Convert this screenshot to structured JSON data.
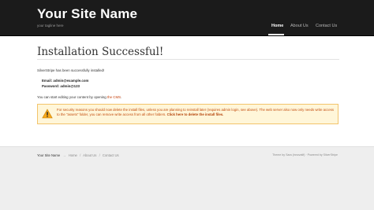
{
  "header": {
    "site_name": "Your Site Name",
    "tagline": "your tagline here",
    "nav": [
      {
        "label": "Home",
        "active": true
      },
      {
        "label": "About Us",
        "active": false
      },
      {
        "label": "Contact Us",
        "active": false
      }
    ]
  },
  "main": {
    "title": "Installation Successful!",
    "intro": "SilverStripe has been successfully installed!",
    "email_line": "Email: admin@example.com",
    "password_line": "Password: admin@123",
    "edit_text": "You can start editing your content by opening",
    "cms_link": "the CMS",
    "edit_suffix": "."
  },
  "warning": {
    "line1": "For security reasons you should now delete the install files, unless you are planning to reinstall later (requires admin login, see above). The web server also now only needs",
    "line2": "write access to the \"assets\" folder, you can remove write access from all other folders.",
    "delete_link": "Click here to delete the install files.",
    "accent_color": "#f3c46b",
    "background_color": "#fff6d9"
  },
  "footer": {
    "breadcrumb": {
      "site": "Your Site Name",
      "arrow": "→",
      "links": [
        "Home",
        "About Us",
        "Contact Us"
      ]
    },
    "credits": "Theme by Sara (innovatif) · Powered by SilverStripe"
  }
}
